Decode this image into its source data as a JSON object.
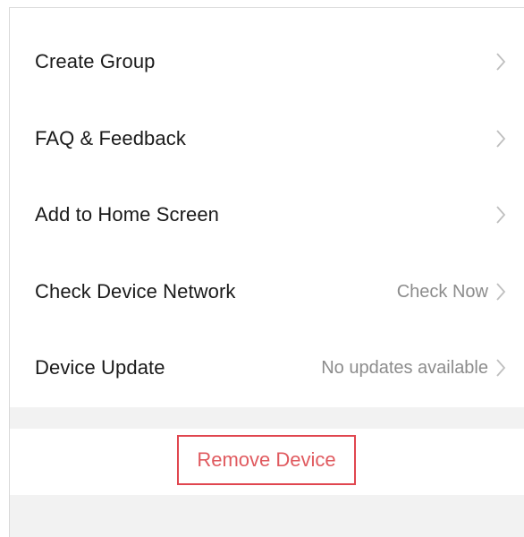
{
  "settings": {
    "items": [
      {
        "label": "Create Group",
        "value": ""
      },
      {
        "label": "FAQ & Feedback",
        "value": ""
      },
      {
        "label": "Add to Home Screen",
        "value": ""
      },
      {
        "label": "Check Device Network",
        "value": "Check Now"
      },
      {
        "label": "Device Update",
        "value": "No updates available"
      }
    ]
  },
  "actions": {
    "remove_label": "Remove Device",
    "remove_color": "#e0464f"
  },
  "colors": {
    "section_gap": "#f2f2f2",
    "chevron": "#bfbfbf"
  }
}
